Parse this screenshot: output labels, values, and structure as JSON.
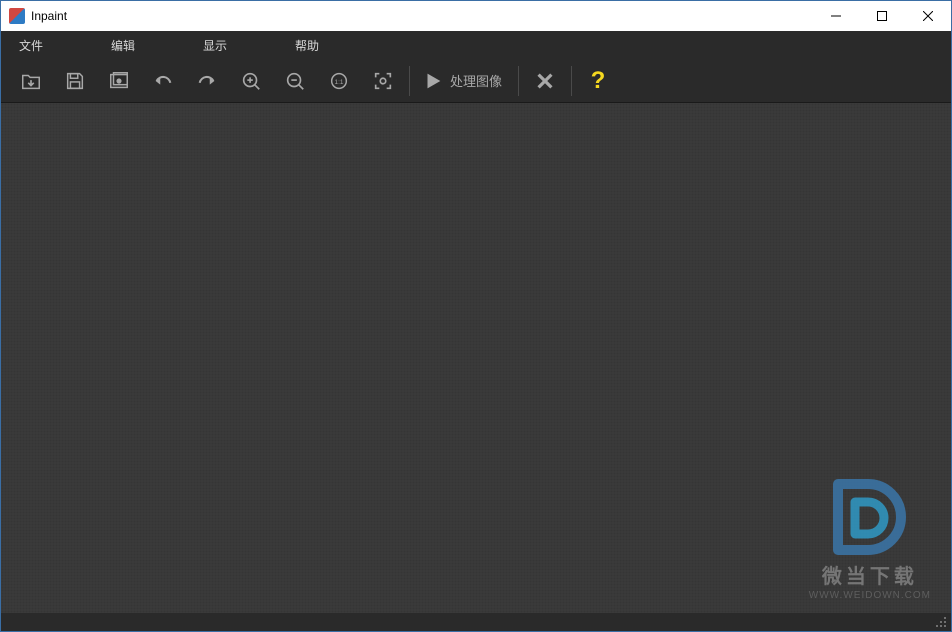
{
  "title": "Inpaint",
  "menu": {
    "file": "文件",
    "edit": "编辑",
    "view": "显示",
    "help": "帮助"
  },
  "toolbar": {
    "process_label": "处理图像",
    "help_symbol": "?"
  },
  "watermark": {
    "line1": "微当下载",
    "line2": "WWW.WEIDOWN.COM"
  }
}
